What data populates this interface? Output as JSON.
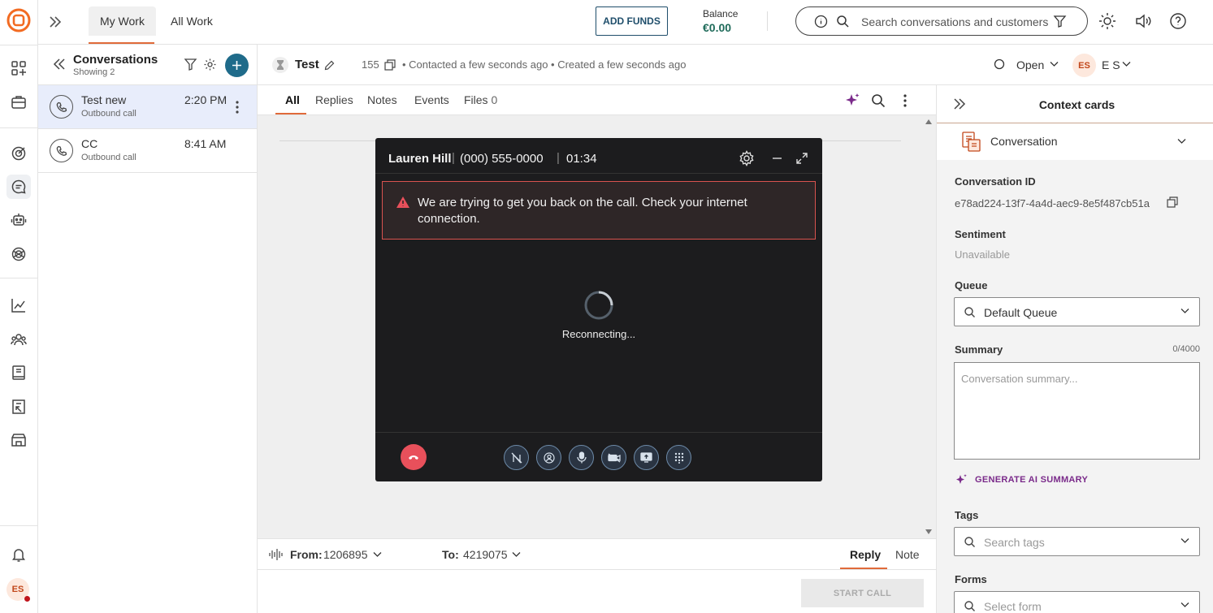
{
  "colors": {
    "brand": "#f26b22",
    "accent_teal": "#1f6b8a",
    "call_bg": "#1c1c1e",
    "alert_border": "#d9534f",
    "hangup": "#e8505b",
    "ai_purple": "#7a2a8a"
  },
  "rail": {
    "icons": [
      "logo-icon",
      "apps-icon",
      "briefcase-icon",
      "target-icon",
      "chat-icon",
      "bot-icon",
      "ai-icon",
      "analytics-icon",
      "contacts-icon",
      "knowledge-icon",
      "reports-icon",
      "store-icon",
      "bell-icon"
    ],
    "avatar": "ES"
  },
  "topbar": {
    "tabs": [
      "My Work",
      "All Work"
    ],
    "add_funds": "ADD FUNDS",
    "balance_label": "Balance",
    "balance_value": "€0.00",
    "search_placeholder": "Search conversations and customers"
  },
  "conversations": {
    "title": "Conversations",
    "subtitle": "Showing 2",
    "items": [
      {
        "name": "Test new",
        "sub": "Outbound call",
        "time": "2:20 PM"
      },
      {
        "name": "CC",
        "sub": "Outbound call",
        "time": "8:41 AM"
      }
    ]
  },
  "conversation": {
    "title": "Test",
    "count": "155",
    "meta": "• Contacted a few seconds ago • Created a few seconds ago",
    "status": "Open",
    "assignee_initials": "ES",
    "assignee_name": "E S",
    "tabs": [
      "All",
      "Replies",
      "Notes",
      "Events",
      "Files"
    ],
    "files_count": "0"
  },
  "call": {
    "name": "Lauren Hill",
    "number": "(000) 555-0000",
    "duration": "01:34",
    "alert": "We are trying to get you back on the call. Check your internet connection.",
    "status": "Reconnecting..."
  },
  "composer": {
    "from_label": "From:",
    "from_value": "1206895",
    "to_label": "To:",
    "to_value": "4219075",
    "reply_tab": "Reply",
    "note_tab": "Note",
    "start_call": "START CALL"
  },
  "context": {
    "title": "Context cards",
    "card": "Conversation",
    "conversation_id_label": "Conversation ID",
    "conversation_id": "e78ad224-13f7-4a4d-aec9-8e5f487cb51a",
    "sentiment_label": "Sentiment",
    "sentiment_value": "Unavailable",
    "queue_label": "Queue",
    "queue_value": "Default Queue",
    "summary_label": "Summary",
    "summary_count": "0/4000",
    "summary_placeholder": "Conversation summary...",
    "generate_ai": "GENERATE AI SUMMARY",
    "tags_label": "Tags",
    "tags_placeholder": "Search tags",
    "forms_label": "Forms",
    "forms_placeholder": "Select form"
  }
}
